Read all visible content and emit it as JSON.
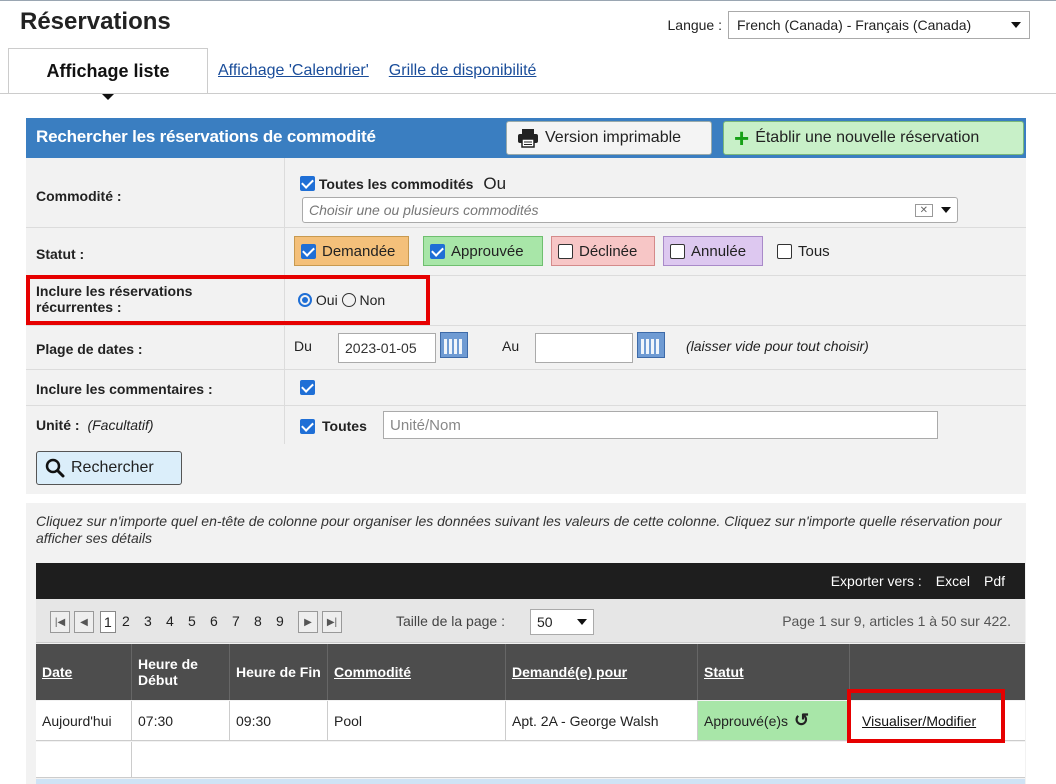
{
  "page": {
    "title": "Réservations"
  },
  "language": {
    "label": "Langue :",
    "selected": "French (Canada) - Français (Canada)"
  },
  "tabs": [
    {
      "label": "Affichage liste"
    },
    {
      "label": "Affichage 'Calendrier'"
    },
    {
      "label": "Grille de disponibilité"
    }
  ],
  "search_panel": {
    "title": "Rechercher les réservations de commodité",
    "print_button": "Version imprimable",
    "new_button": "Établir une nouvelle réservation",
    "amenity": {
      "label": "Commodité :",
      "all_label": "Toutes les commodités",
      "or_label": "Ou",
      "placeholder": "Choisir une ou plusieurs commodités"
    },
    "status": {
      "label": "Statut :",
      "options": [
        {
          "label": "Demandée",
          "checked": true,
          "color": "#f4c07a"
        },
        {
          "label": "Approuvée",
          "checked": true,
          "color": "#a8e6a8"
        },
        {
          "label": "Déclinée",
          "checked": false,
          "color": "#f7c6c6"
        },
        {
          "label": "Annulée",
          "checked": false,
          "color": "#ddc8f0"
        },
        {
          "label": "Tous",
          "checked": false,
          "color": "#f2f2f2"
        }
      ]
    },
    "recurring": {
      "label": "Inclure les réservations récurrentes :",
      "yes": "Oui",
      "no": "Non",
      "selected": "Oui"
    },
    "date_range": {
      "label": "Plage de dates :",
      "from_label": "Du",
      "from_value": "2023-01-05",
      "to_label": "Au",
      "to_value": "",
      "hint": "(laisser vide pour tout choisir)"
    },
    "comments": {
      "label": "Inclure les commentaires :",
      "checked": true
    },
    "unit": {
      "label": "Unité :",
      "optional": "(Facultatif)",
      "all_label": "Toutes",
      "placeholder": "Unité/Nom"
    },
    "search_button": "Rechercher"
  },
  "results": {
    "hint": "Cliquez sur n'importe quel en-tête de colonne pour organiser les données suivant les valeurs de cette colonne. Cliquez sur n'importe quelle réservation pour afficher ses détails",
    "export": {
      "label": "Exporter vers :",
      "excel": "Excel",
      "pdf": "Pdf"
    },
    "pager": {
      "pages": [
        "1",
        "2",
        "3",
        "4",
        "5",
        "6",
        "7",
        "8",
        "9"
      ],
      "current_page": "1",
      "page_size_label": "Taille de la page :",
      "page_size": "50",
      "summary": "Page 1 sur 9, articles 1 à 50 sur 422."
    },
    "columns": [
      "Date",
      "Heure de Début",
      "Heure de Fin",
      "Commodité",
      "Demandé(e) pour",
      "Statut",
      ""
    ],
    "rows": [
      {
        "date": "Aujourd'hui",
        "start": "07:30",
        "end": "09:30",
        "amenity": "Pool",
        "requested_for": "Apt. 2A - George Walsh",
        "status": "Approuvé(e)s",
        "action": "Visualiser/Modifier"
      }
    ]
  },
  "colors": {
    "header_blue": "#3a7ec1",
    "highlight_red": "#e60000",
    "approved_green": "#a8e6a8"
  }
}
